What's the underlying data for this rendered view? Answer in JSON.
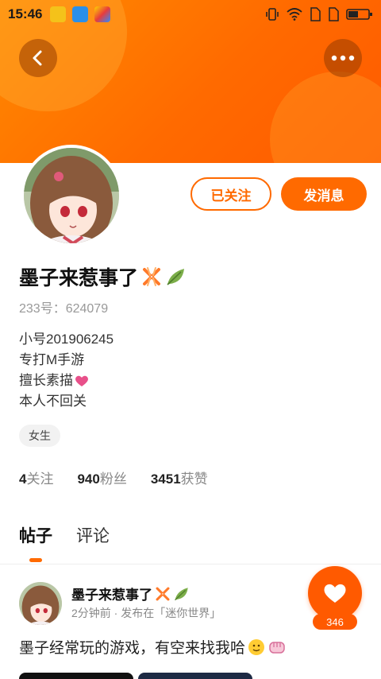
{
  "status_bar": {
    "time": "15:46",
    "icons": [
      "app-notification-icon",
      "scan-icon",
      "game-app-icon",
      "vibrate-icon",
      "wifi-icon",
      "sim1-icon",
      "sim2-icon",
      "battery-icon"
    ]
  },
  "header": {
    "back_icon": "chevron-left-icon",
    "more_icon": "more-dots-icon",
    "accent_color": "#ff6a00"
  },
  "profile": {
    "name": "墨子来惹事了",
    "name_emojis": [
      "anger-icon",
      "leaf-icon"
    ],
    "id_text": "233号：624079",
    "bio": [
      "小号201906245",
      "专打M手游",
      "擅长素描",
      "本人不回关"
    ],
    "bio_emoji": "heart-icon",
    "gender": "女生",
    "follow_button": "已关注",
    "message_button": "发消息"
  },
  "stats": [
    {
      "number": "4",
      "label": "关注"
    },
    {
      "number": "940",
      "label": "粉丝"
    },
    {
      "number": "3451",
      "label": "获赞"
    }
  ],
  "tabs": [
    {
      "label": "帖子",
      "active": true
    },
    {
      "label": "评论",
      "active": false
    }
  ],
  "post": {
    "author": "墨子来惹事了",
    "meta": "2分钟前 · 发布在「迷你世界」",
    "text": "墨子经常玩的游戏，有空来找我哈",
    "likes": "346"
  }
}
